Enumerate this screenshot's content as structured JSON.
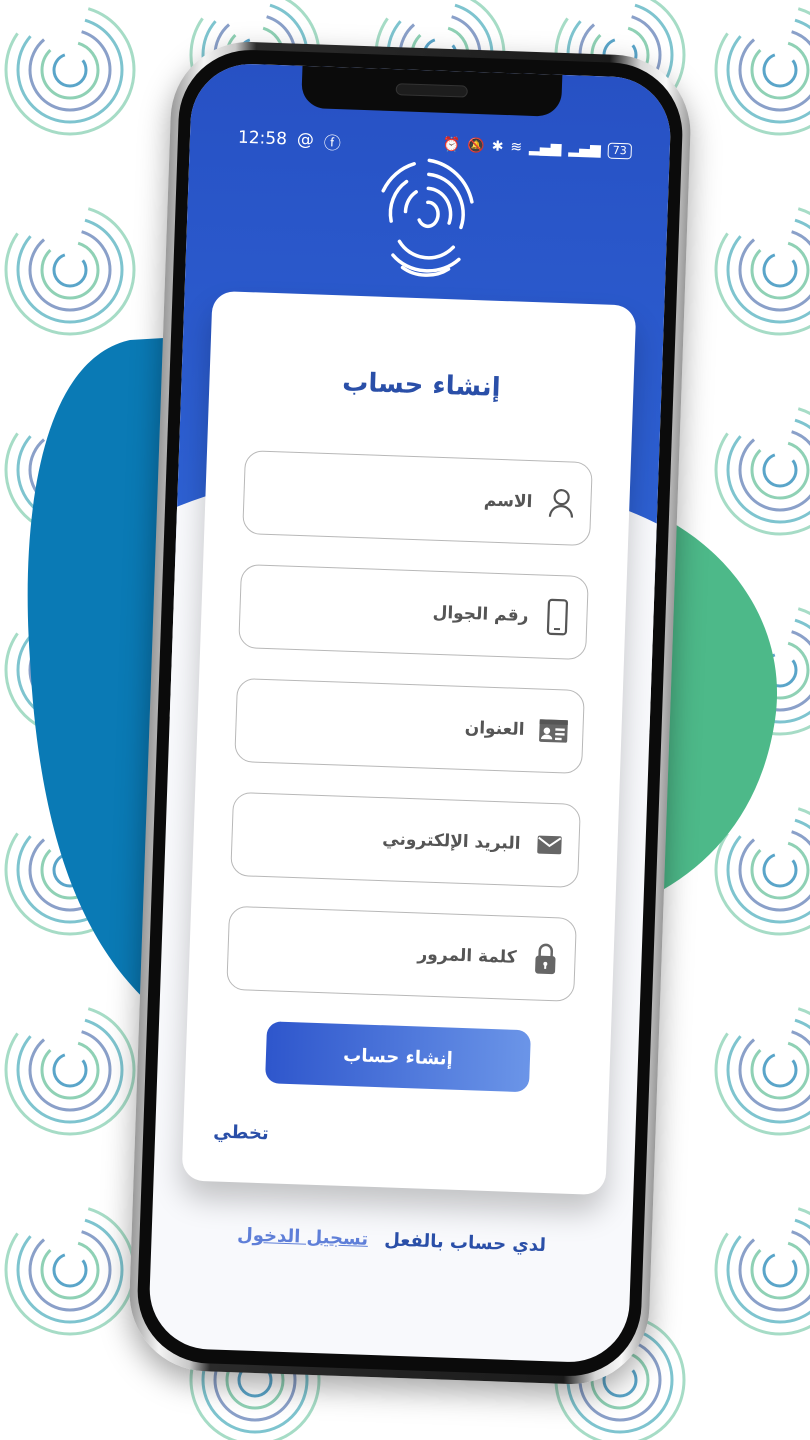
{
  "status_bar": {
    "time": "12:58",
    "left_icons": [
      "threads-icon",
      "facebook-icon"
    ],
    "right_icons": [
      "alarm-icon",
      "mute-icon",
      "bluetooth-icon",
      "wifi-icon",
      "signal-icon",
      "signal-icon"
    ],
    "battery": "73"
  },
  "signup": {
    "title": "إنشاء حساب",
    "fields": [
      {
        "placeholder": "الاسم",
        "icon": "user-icon"
      },
      {
        "placeholder": "رقم الجوال",
        "icon": "phone-icon"
      },
      {
        "placeholder": "العنوان",
        "icon": "id-card-icon"
      },
      {
        "placeholder": "البريد الإلكتروني",
        "icon": "mail-icon"
      },
      {
        "placeholder": "كلمة المرور",
        "icon": "lock-icon"
      }
    ],
    "submit_label": "إنشاء حساب",
    "skip_label": "تخطي"
  },
  "footer": {
    "question": "لدي حساب بالفعل",
    "login_link": "تسجيل الدخول"
  },
  "colors": {
    "primary": "#2a4fa8",
    "header_blue": "#2e62d4",
    "blob_blue": "#0a7ab5",
    "blob_green": "#4db989"
  }
}
